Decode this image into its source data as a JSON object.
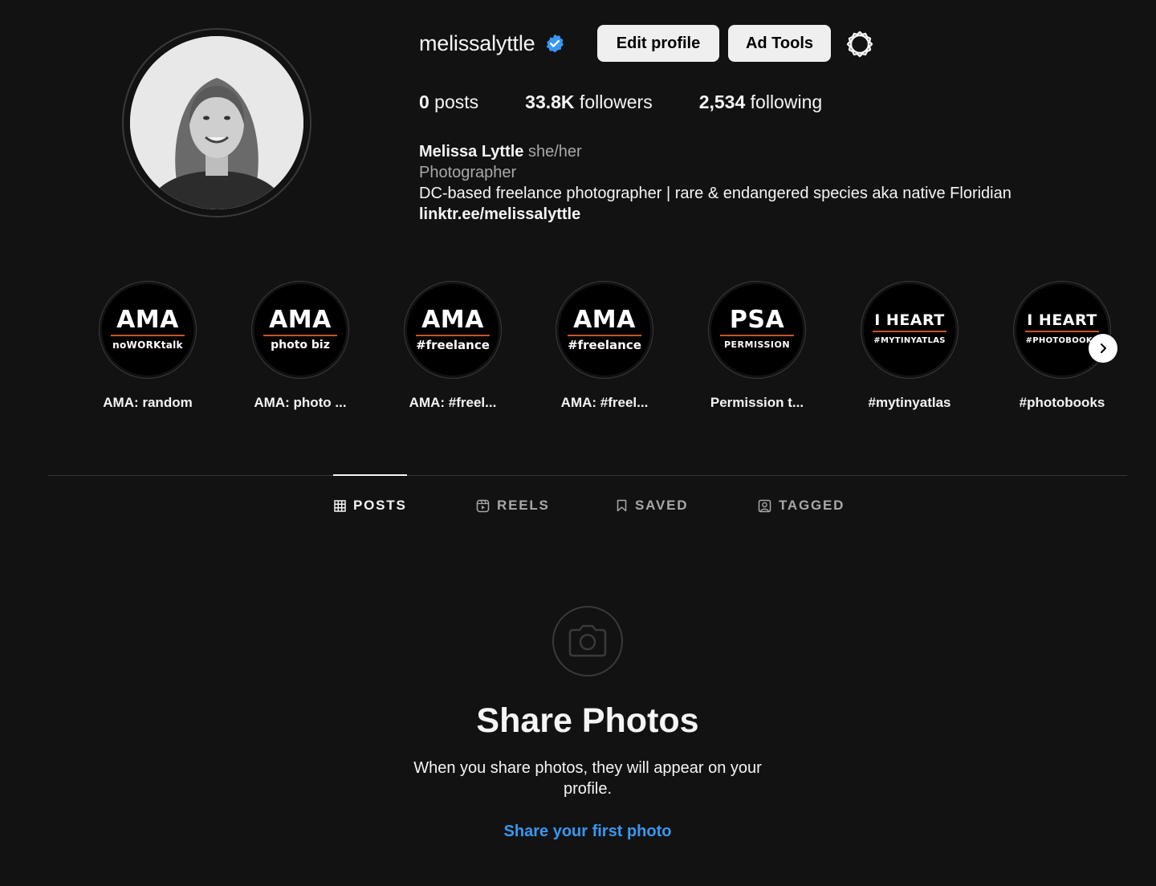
{
  "profile": {
    "username": "melissalyttle",
    "edit_label": "Edit profile",
    "ad_tools_label": "Ad Tools",
    "stats": [
      {
        "num": "0",
        "label": " posts"
      },
      {
        "num": "33.8K",
        "label": " followers"
      },
      {
        "num": "2,534",
        "label": " following"
      }
    ],
    "display_name": "Melissa Lyttle",
    "pronouns": " she/her",
    "category": "Photographer",
    "bio": "DC-based freelance photographer | rare & endangered species aka native Floridian",
    "link": "linktr.ee/melissalyttle"
  },
  "highlights": [
    {
      "big": "AMA",
      "sub": "noWORKtalk",
      "label": "AMA: random"
    },
    {
      "big": "AMA",
      "sub": "photo biz",
      "label": "AMA: photo ..."
    },
    {
      "big": "AMA",
      "sub": "#freelance",
      "label": "AMA: #freel..."
    },
    {
      "big": "AMA",
      "sub": "#freelance",
      "label": "AMA: #freel..."
    },
    {
      "big": "PSA",
      "sub": "PERMISSION",
      "label": "Permission t..."
    },
    {
      "big": "I HEART",
      "sub": "#MYTINYATLAS",
      "label": "#mytinyatlas"
    },
    {
      "big": "I HEART",
      "sub": "#PHOTOBOOKS",
      "label": "#photobooks"
    }
  ],
  "tabs": [
    {
      "label": "POSTS"
    },
    {
      "label": "REELS"
    },
    {
      "label": "SAVED"
    },
    {
      "label": "TAGGED"
    }
  ],
  "empty_state": {
    "title": "Share Photos",
    "text": "When you share photos, they will appear on your profile.",
    "link": "Share your first photo"
  },
  "colors": {
    "background": "#121212",
    "link_blue": "#3897f0",
    "verified_blue": "#3897f0",
    "highlight_underline": "#c9542a"
  }
}
